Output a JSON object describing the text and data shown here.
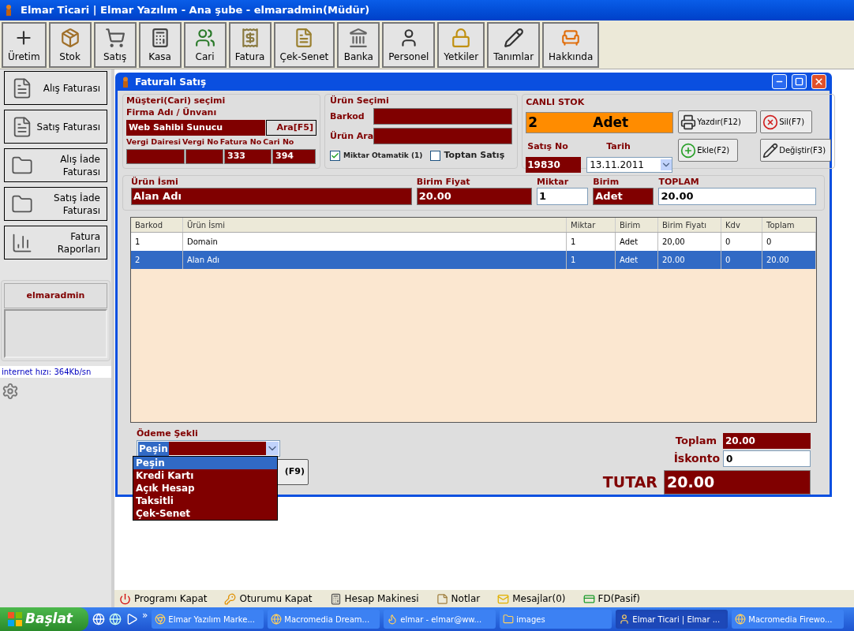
{
  "window": {
    "title": "Elmar Ticari | Elmar Yazılım - Ana şube - elmaradmin(Müdür)"
  },
  "toolbar": [
    {
      "label": "Üretim"
    },
    {
      "label": "Stok"
    },
    {
      "label": "Satış"
    },
    {
      "label": "Kasa"
    },
    {
      "label": "Cari"
    },
    {
      "label": "Fatura"
    },
    {
      "label": "Çek-Senet"
    },
    {
      "label": "Banka"
    },
    {
      "label": "Personel"
    },
    {
      "label": "Yetkiler"
    },
    {
      "label": "Tanımlar"
    },
    {
      "label": "Hakkında"
    }
  ],
  "sidebar": {
    "items": [
      {
        "lines": [
          "Alış Faturası"
        ]
      },
      {
        "lines": [
          "Satış Faturası"
        ]
      },
      {
        "lines": [
          "Alış İade",
          "Faturası"
        ]
      },
      {
        "lines": [
          "Satış İade",
          "Faturası"
        ]
      },
      {
        "lines": [
          "Fatura",
          "Raporları"
        ]
      }
    ],
    "user": "elmaradmin",
    "speed": "internet hızı: 364Kb/sn"
  },
  "dialog": {
    "title": "Faturalı Satış",
    "customer": {
      "legend": "Müşteri(Cari) seçimi",
      "firm_label": "Firma Adı / Ünvanı",
      "firm_value": "Web Sahibi Sunucu",
      "search_button": "Ara[F5]",
      "fields": [
        {
          "label": "Vergi Dairesi"
        },
        {
          "label": "Vergi No"
        },
        {
          "label": "Fatura No",
          "value": "333"
        },
        {
          "label": "Cari No",
          "value": "394"
        }
      ]
    },
    "product": {
      "legend": "Ürün Seçimi",
      "fields": [
        {
          "label": "Barkod"
        },
        {
          "label": "Ürün Ara"
        }
      ],
      "checkboxes": [
        {
          "label": "Miktar Otamatik (1)",
          "checked": true
        },
        {
          "label": "Toptan Satış",
          "checked": false
        }
      ]
    },
    "stock": {
      "legend": "CANLI STOK",
      "quantity": "2",
      "unit": "Adet",
      "sale_no_label": "Satış No",
      "sale_no": "19830",
      "date_label": "Tarih",
      "date": "13.11.2011",
      "buttons": [
        {
          "label": "Yazdır(F12)"
        },
        {
          "label": "Sil(F7)"
        },
        {
          "label": "Ekle(F2)"
        },
        {
          "label": "Değiştir(F3)"
        }
      ]
    },
    "entry": [
      {
        "label": "Ürün İsmi",
        "value": "Alan Adı",
        "kind": "dark"
      },
      {
        "label": "Birim Fiyat",
        "value": "20.00",
        "kind": "dark"
      },
      {
        "label": "Miktar",
        "value": "1",
        "kind": "white"
      },
      {
        "label": "Birim",
        "value": "Adet",
        "kind": "dark"
      },
      {
        "label": "TOPLAM",
        "value": "20.00",
        "kind": "white"
      }
    ],
    "table": {
      "columns": [
        "Barkod",
        "Ürün İsmi",
        "Miktar",
        "Birim",
        "Birim Fiyatı",
        "Kdv",
        "Toplam"
      ],
      "rows": [
        {
          "cells": [
            "1",
            "Domain",
            "1",
            "Adet",
            "20,00",
            "0",
            "0"
          ],
          "selected": false
        },
        {
          "cells": [
            "2",
            "Alan Adı",
            "1",
            "Adet",
            "20.00",
            "0",
            "20.00"
          ],
          "selected": true
        }
      ]
    },
    "payment": {
      "label": "Ödeme Şekli",
      "value": "Peşin",
      "hidden_button": "(F9)",
      "options": [
        {
          "label": "Peşin",
          "selected": true
        },
        {
          "label": "Kredi Kartı",
          "selected": false
        },
        {
          "label": "Açık Hesap",
          "selected": false
        },
        {
          "label": "Taksitli",
          "selected": false
        },
        {
          "label": "Çek-Senet",
          "selected": false
        }
      ]
    },
    "totals": {
      "total_label": "Toplam",
      "total": "20.00",
      "discount_label": "İskonto",
      "discount": "0",
      "grand_label": "TUTAR",
      "grand": "20.00"
    }
  },
  "bottom_bar": [
    {
      "label": "Programı Kapat"
    },
    {
      "label": "Oturumu Kapat"
    },
    {
      "label": "Hesap Makinesi"
    },
    {
      "label": "Notlar"
    },
    {
      "label": "Mesajlar(0)"
    },
    {
      "label": "FD(Pasif)"
    }
  ],
  "taskbar": {
    "start": "Başlat",
    "more": "»",
    "tasks": [
      {
        "label": "Elmar Yazılım Marke...",
        "selected": false
      },
      {
        "label": "Macromedia Dream...",
        "selected": false
      },
      {
        "label": "elmar - elmar@ww...",
        "selected": false
      },
      {
        "label": "images",
        "selected": false
      },
      {
        "label": "Elmar Ticari | Elmar ...",
        "selected": true
      },
      {
        "label": "Macromedia Firewo...",
        "selected": false
      }
    ]
  }
}
